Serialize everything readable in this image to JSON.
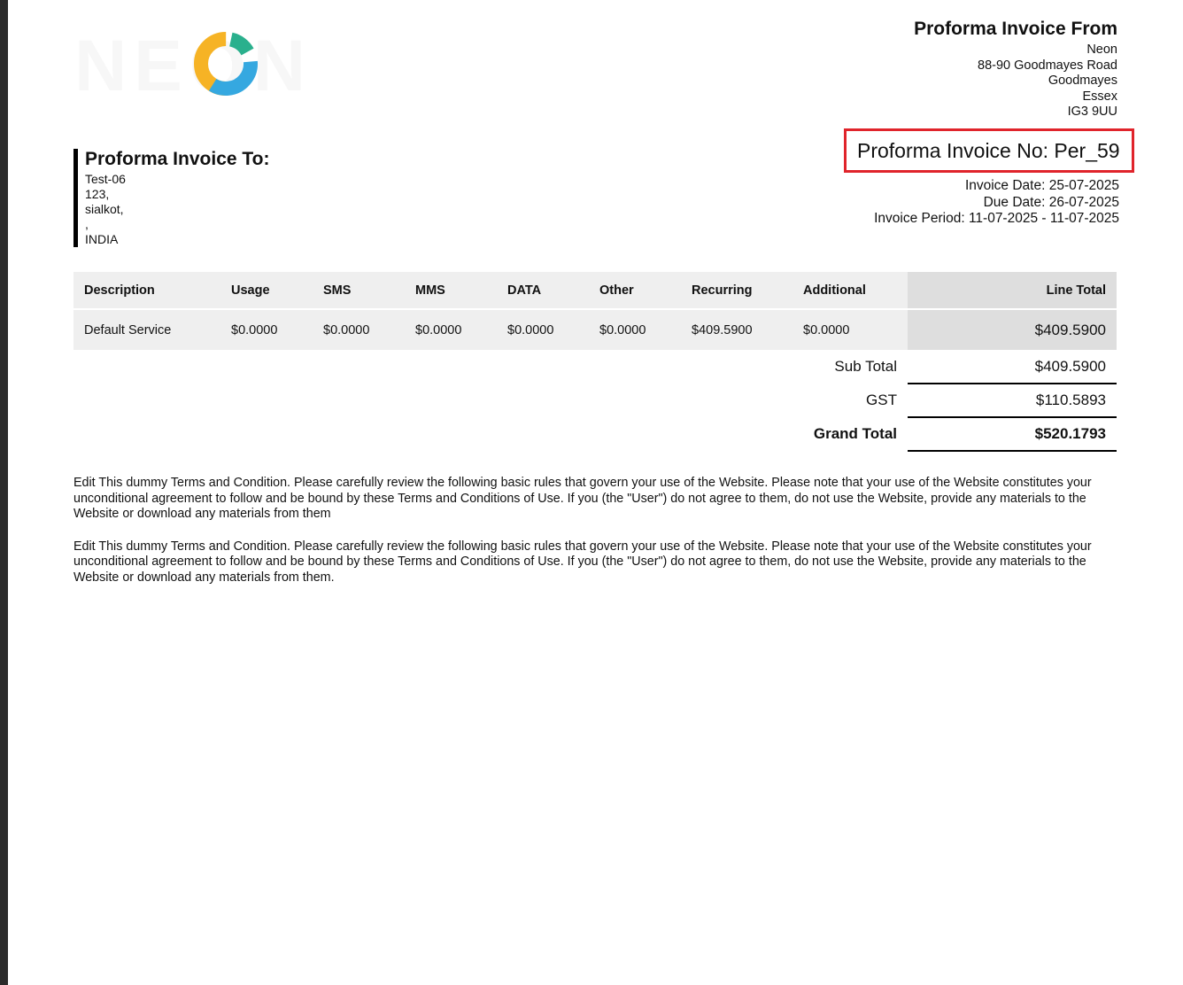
{
  "logo": {
    "text": "NEON",
    "icon": "donut-chart-logo-icon",
    "colors": {
      "orange": "#f6b325",
      "teal": "#2ab08d",
      "blue": "#35a8e0"
    }
  },
  "from": {
    "title": "Proforma Invoice From",
    "lines": [
      "Neon",
      "88-90 Goodmayes Road",
      "Goodmayes",
      "Essex",
      "IG3 9UU"
    ]
  },
  "to": {
    "title": "Proforma Invoice To:",
    "lines": [
      "Test-06",
      "123,",
      "sialkot,",
      ",",
      "INDIA"
    ]
  },
  "invoice": {
    "number_label": "Proforma Invoice No: Per_59",
    "invoice_date": "Invoice Date: 25-07-2025",
    "due_date": "Due Date: 26-07-2025",
    "period": "Invoice Period: 11-07-2025 - 11-07-2025",
    "highlight_color": "#e0242b"
  },
  "table": {
    "headers": [
      "Description",
      "Usage",
      "SMS",
      "MMS",
      "DATA",
      "Other",
      "Recurring",
      "Additional",
      "Line Total"
    ],
    "rows": [
      [
        "Default Service",
        "$0.0000",
        "$0.0000",
        "$0.0000",
        "$0.0000",
        "$0.0000",
        "$409.5900",
        "$0.0000",
        "$409.5900"
      ]
    ]
  },
  "summary": {
    "subtotal_label": "Sub Total",
    "subtotal_value": "$409.5900",
    "gst_label": "GST",
    "gst_value": "$110.5893",
    "grand_label": "Grand Total",
    "grand_value": "$520.1793"
  },
  "terms": [
    "Edit This dummy Terms and Condition. Please carefully review the following basic rules that govern your use of the Website. Please note that your use of the Website constitutes your unconditional agreement to follow and be bound by these Terms and Conditions of Use. If you (the \"User\") do not agree to them, do not use the Website, provide any materials to the Website or download any materials from them",
    "Edit This dummy Terms and Condition. Please carefully review the following basic rules that govern your use of the Website. Please note that your use of the Website constitutes your unconditional agreement to follow and be bound by these Terms and Conditions of Use. If you (the \"User\") do not agree to them, do not use the Website, provide any materials to the Website or download any materials from them."
  ]
}
